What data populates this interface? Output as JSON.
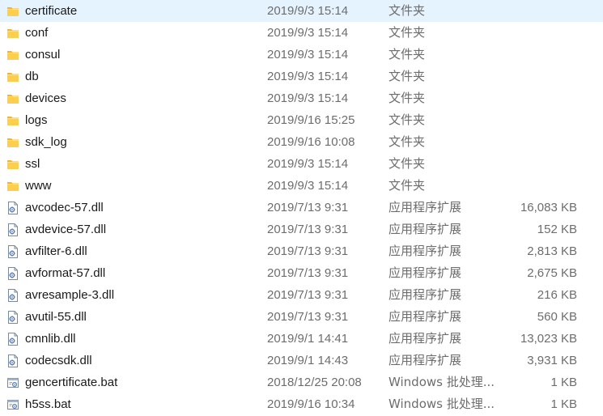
{
  "colors": {
    "folder_body": "#ffce4a",
    "folder_tab": "#f2b431",
    "file_border": "#7a8a9c",
    "file_gear": "#5a7db8",
    "text_primary": "#1a1a1a",
    "text_secondary": "#6d6d6d"
  },
  "files": [
    {
      "name": "certificate",
      "date": "2019/9/3 15:14",
      "type": "文件夹",
      "size": "",
      "icon": "folder-icon"
    },
    {
      "name": "conf",
      "date": "2019/9/3 15:14",
      "type": "文件夹",
      "size": "",
      "icon": "folder-icon"
    },
    {
      "name": "consul",
      "date": "2019/9/3 15:14",
      "type": "文件夹",
      "size": "",
      "icon": "folder-icon"
    },
    {
      "name": "db",
      "date": "2019/9/3 15:14",
      "type": "文件夹",
      "size": "",
      "icon": "folder-icon"
    },
    {
      "name": "devices",
      "date": "2019/9/3 15:14",
      "type": "文件夹",
      "size": "",
      "icon": "folder-icon"
    },
    {
      "name": "logs",
      "date": "2019/9/16 15:25",
      "type": "文件夹",
      "size": "",
      "icon": "folder-icon"
    },
    {
      "name": "sdk_log",
      "date": "2019/9/16 10:08",
      "type": "文件夹",
      "size": "",
      "icon": "folder-icon"
    },
    {
      "name": "ssl",
      "date": "2019/9/3 15:14",
      "type": "文件夹",
      "size": "",
      "icon": "folder-icon"
    },
    {
      "name": "www",
      "date": "2019/9/3 15:14",
      "type": "文件夹",
      "size": "",
      "icon": "folder-icon"
    },
    {
      "name": "avcodec-57.dll",
      "date": "2019/7/13 9:31",
      "type": "应用程序扩展",
      "size": "16,083 KB",
      "icon": "dll-file-icon"
    },
    {
      "name": "avdevice-57.dll",
      "date": "2019/7/13 9:31",
      "type": "应用程序扩展",
      "size": "152 KB",
      "icon": "dll-file-icon"
    },
    {
      "name": "avfilter-6.dll",
      "date": "2019/7/13 9:31",
      "type": "应用程序扩展",
      "size": "2,813 KB",
      "icon": "dll-file-icon"
    },
    {
      "name": "avformat-57.dll",
      "date": "2019/7/13 9:31",
      "type": "应用程序扩展",
      "size": "2,675 KB",
      "icon": "dll-file-icon"
    },
    {
      "name": "avresample-3.dll",
      "date": "2019/7/13 9:31",
      "type": "应用程序扩展",
      "size": "216 KB",
      "icon": "dll-file-icon"
    },
    {
      "name": "avutil-55.dll",
      "date": "2019/7/13 9:31",
      "type": "应用程序扩展",
      "size": "560 KB",
      "icon": "dll-file-icon"
    },
    {
      "name": "cmnlib.dll",
      "date": "2019/9/1 14:41",
      "type": "应用程序扩展",
      "size": "13,023 KB",
      "icon": "dll-file-icon"
    },
    {
      "name": "codecsdk.dll",
      "date": "2019/9/1 14:43",
      "type": "应用程序扩展",
      "size": "3,931 KB",
      "icon": "dll-file-icon"
    },
    {
      "name": "gencertificate.bat",
      "date": "2018/12/25 20:08",
      "type": "Windows 批处理...",
      "size": "1 KB",
      "icon": "bat-file-icon"
    },
    {
      "name": "h5ss.bat",
      "date": "2019/9/16 10:34",
      "type": "Windows 批处理...",
      "size": "1 KB",
      "icon": "bat-file-icon"
    }
  ]
}
